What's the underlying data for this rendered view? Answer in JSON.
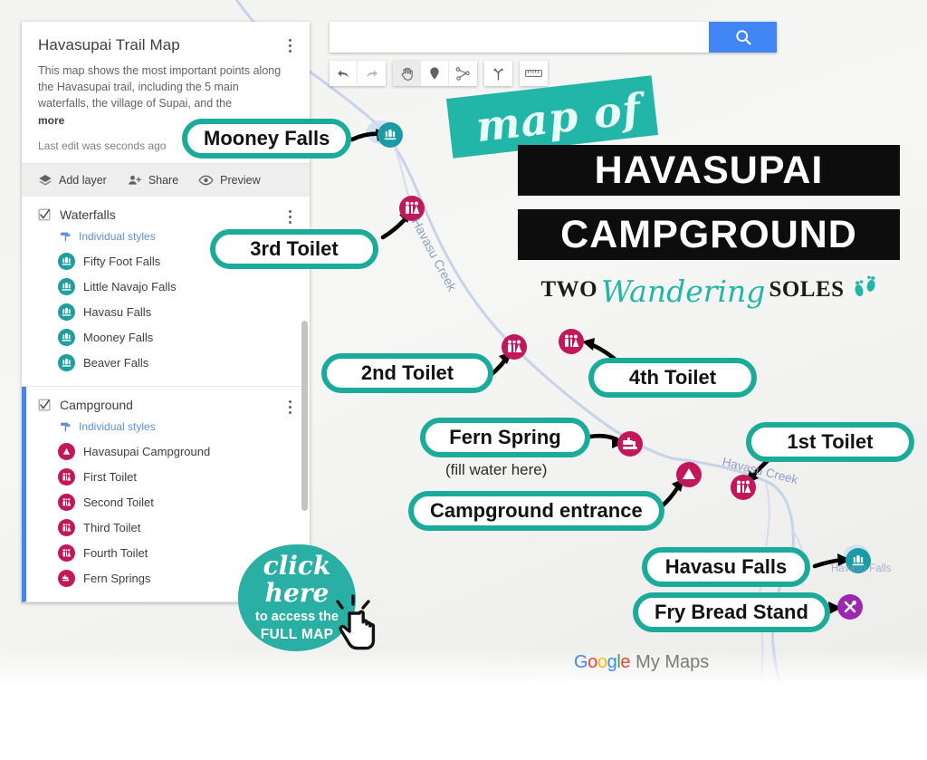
{
  "sidebar": {
    "title": "Havasupai Trail Map",
    "description": "This map shows the most important points along the Havasupai trail, including the 5 main waterfalls, the village of Supai, and the",
    "more_link": "more",
    "last_edit": "Last edit was seconds ago",
    "actions": [
      {
        "label": "Add layer",
        "icon": "layers-icon"
      },
      {
        "label": "Share",
        "icon": "person-add-icon"
      },
      {
        "label": "Preview",
        "icon": "eye-icon"
      }
    ],
    "layers": [
      {
        "name": "Waterfalls",
        "checked": true,
        "styles_label": "Individual styles",
        "marker_color": "#1e9e9e",
        "marker_icon": "waterfall-icon",
        "features": [
          "Fifty Foot Falls",
          "Little Navajo Falls",
          "Havasu Falls",
          "Mooney Falls",
          "Beaver Falls"
        ]
      },
      {
        "name": "Campground",
        "checked": true,
        "styles_label": "Individual styles",
        "marker_color": "#c2185b",
        "features": [
          {
            "label": "Havasupai Campground",
            "icon": "campground-icon"
          },
          {
            "label": "First Toilet",
            "icon": "restroom-icon"
          },
          {
            "label": "Second Toilet",
            "icon": "restroom-icon"
          },
          {
            "label": "Third Toilet",
            "icon": "restroom-icon"
          },
          {
            "label": "Fourth Toilet",
            "icon": "restroom-icon"
          },
          {
            "label": "Fern Springs",
            "icon": "water-tap-icon"
          }
        ]
      }
    ]
  },
  "search": {
    "value": "",
    "placeholder": "",
    "button_icon": "search-icon",
    "button_color": "#4285f4"
  },
  "toolbar": {
    "buttons": [
      {
        "name": "undo-button",
        "icon": "undo-icon",
        "selected": false
      },
      {
        "name": "redo-button",
        "icon": "redo-icon",
        "selected": false
      },
      {
        "name": "pan-button",
        "icon": "hand-icon",
        "selected": true
      },
      {
        "name": "marker-button",
        "icon": "map-pin-icon",
        "selected": false
      },
      {
        "name": "line-button",
        "icon": "polyline-icon",
        "selected": false
      },
      {
        "name": "directions-button",
        "icon": "directions-icon",
        "selected": false
      },
      {
        "name": "measure-button",
        "icon": "ruler-icon",
        "selected": false
      }
    ]
  },
  "title_block": {
    "script_word": "map of",
    "line1": "HAVASUPAI",
    "line2": "CAMPGROUND",
    "banner_color": "#21b6a8",
    "bar_color": "#0d0d0d"
  },
  "logo": {
    "word1": "TWO",
    "script": "Wandering",
    "word2": "SOLES",
    "accent_color": "#21b6a8"
  },
  "callouts": [
    {
      "text": "Mooney Falls",
      "sub": ""
    },
    {
      "text": "3rd Toilet",
      "sub": ""
    },
    {
      "text": "2nd Toilet",
      "sub": ""
    },
    {
      "text": "4th Toilet",
      "sub": ""
    },
    {
      "text": "Fern Spring",
      "sub": "(fill water here)"
    },
    {
      "text": "1st Toilet",
      "sub": ""
    },
    {
      "text": "Campground entrance",
      "sub": ""
    },
    {
      "text": "Havasu Falls",
      "sub": ""
    },
    {
      "text": "Fry Bread Stand",
      "sub": ""
    }
  ],
  "callout_sub_fern": "(fill water here)",
  "map_labels": {
    "creek_upper": "Havasu Creek",
    "creek_lower": "Havasu Creek",
    "havasu_falls": "Havasu Falls"
  },
  "badge": {
    "line1": "click here",
    "line2": "to access the",
    "line3": "FULL MAP",
    "color": "#2aafa4",
    "cursor_icon": "click-hand-icon"
  },
  "attribution": {
    "g1": "G",
    "g2": "o",
    "g3": "o",
    "g4": "g",
    "g5": "l",
    "g6": "e",
    "suffix": "My Maps"
  },
  "colors": {
    "teal": "#1aab9b",
    "pink": "#c2185b",
    "purple": "#9c27b0",
    "blue": "#4285f4",
    "creek": "#c3cfe8"
  }
}
